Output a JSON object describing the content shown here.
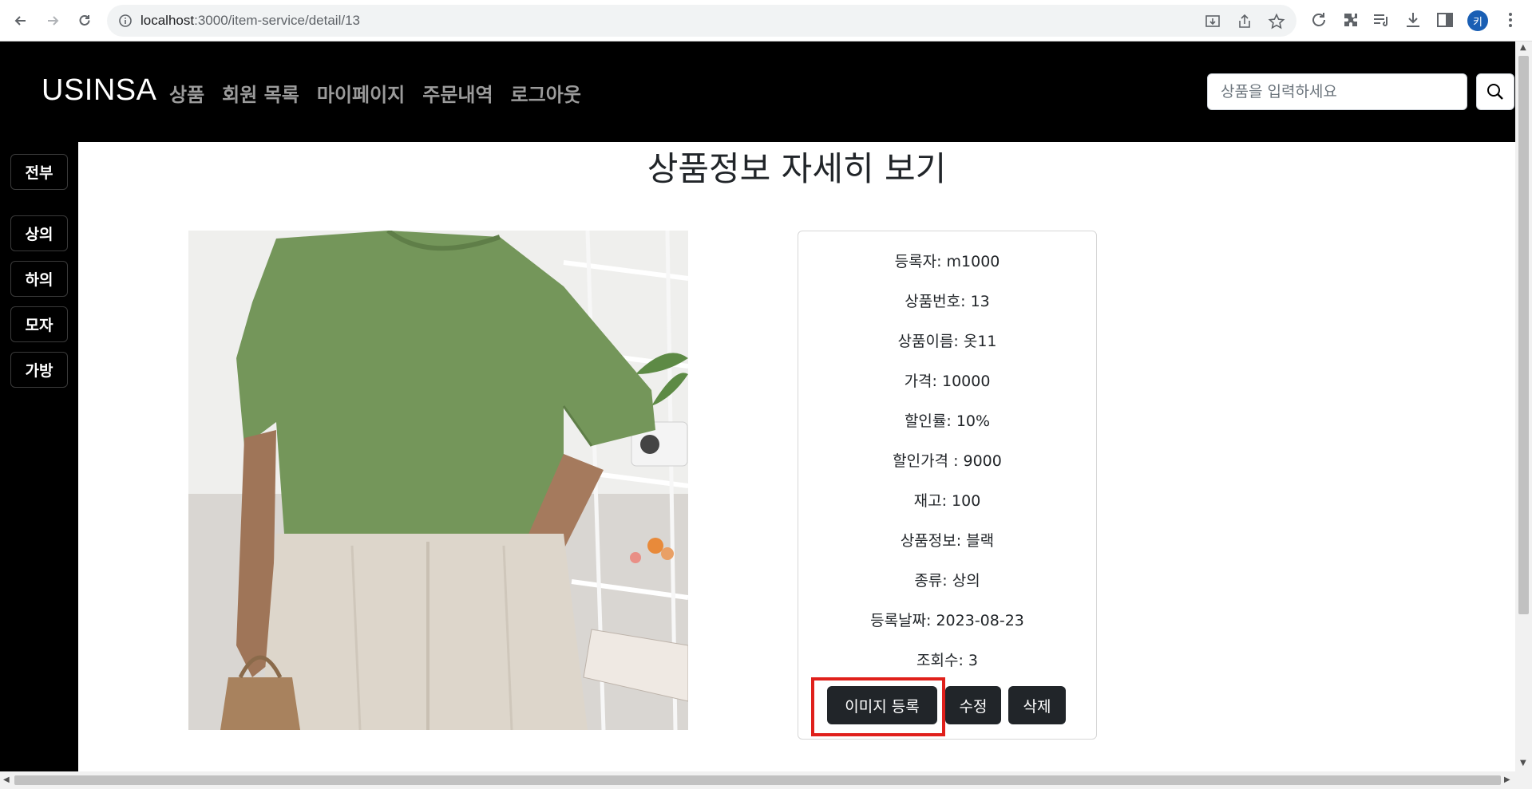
{
  "browser": {
    "url_host": "localhost",
    "url_path": ":3000/item-service/detail/13",
    "profile_initial": "키"
  },
  "header": {
    "brand": "USINSA",
    "menu": [
      {
        "label": "상품"
      },
      {
        "label": "회원 목록"
      },
      {
        "label": "마이페이지"
      },
      {
        "label": "주문내역"
      },
      {
        "label": "로그아웃"
      }
    ],
    "search_placeholder": "상품을 입력하세요"
  },
  "sidebar": {
    "categories": [
      {
        "label": "전부"
      },
      {
        "label": "상의"
      },
      {
        "label": "하의"
      },
      {
        "label": "모자"
      },
      {
        "label": "가방"
      }
    ]
  },
  "main": {
    "title": "상품정보 자세히 보기",
    "info_lines": [
      "등록자: m1000",
      "상품번호: 13",
      "상품이름: 옷11",
      "가격: 10000",
      "할인률: 10%",
      "할인가격 : 9000",
      "재고: 100",
      "상품정보: 블랙",
      "종류: 상의",
      "등록날짜: 2023-08-23",
      "조회수: 3"
    ],
    "buttons": {
      "image_register": "이미지 등록",
      "edit": "수정",
      "delete": "삭제"
    }
  },
  "colors": {
    "header_bg": "#000000",
    "button_dark": "#212529",
    "highlight": "#e0201b"
  }
}
